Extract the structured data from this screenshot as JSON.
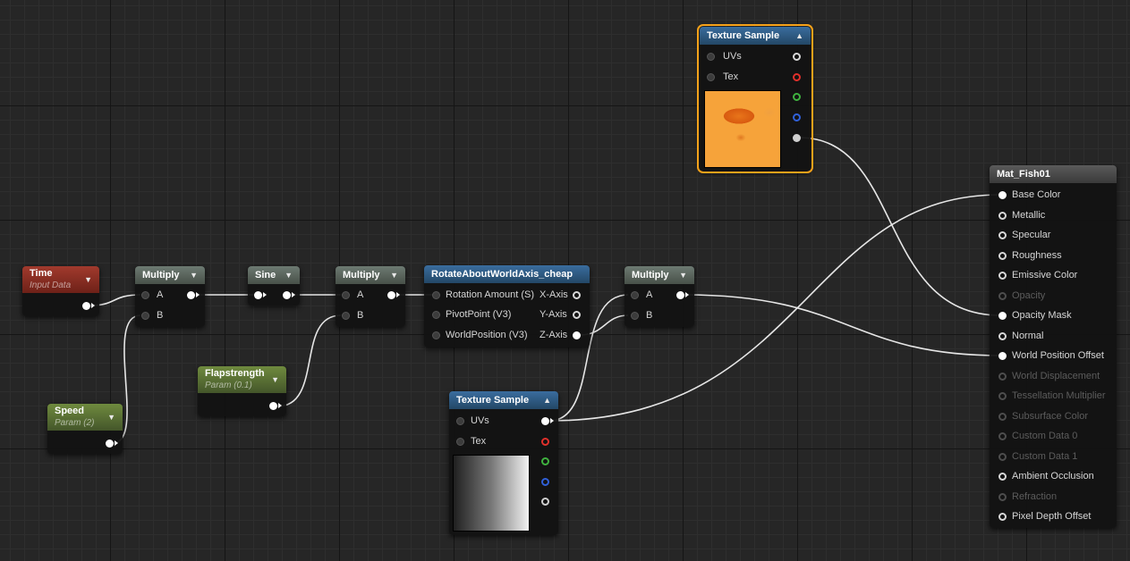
{
  "nodes": {
    "time": {
      "title": "Time",
      "subtitle": "Input Data"
    },
    "speed": {
      "title": "Speed",
      "subtitle": "Param (2)"
    },
    "multiply1": {
      "title": "Multiply",
      "pin_a": "A",
      "pin_b": "B"
    },
    "sine": {
      "title": "Sine"
    },
    "flapstrength": {
      "title": "Flapstrength",
      "subtitle": "Param (0.1)"
    },
    "multiply2": {
      "title": "Multiply",
      "pin_a": "A",
      "pin_b": "B"
    },
    "rotate": {
      "title": "RotateAboutWorldAxis_cheap",
      "inputs": [
        "Rotation Amount (S)",
        "PivotPoint (V3)",
        "WorldPosition (V3)"
      ],
      "outputs": [
        "X-Axis",
        "Y-Axis",
        "Z-Axis"
      ]
    },
    "multiply3": {
      "title": "Multiply",
      "pin_a": "A",
      "pin_b": "B"
    },
    "texture_top": {
      "title": "Texture Sample",
      "uvs": "UVs",
      "tex": "Tex"
    },
    "texture_bottom": {
      "title": "Texture Sample",
      "uvs": "UVs",
      "tex": "Tex"
    },
    "material": {
      "title": "Mat_Fish01",
      "pins": [
        "Base Color",
        "Metallic",
        "Specular",
        "Roughness",
        "Emissive Color",
        "Opacity",
        "Opacity Mask",
        "Normal",
        "World Position Offset",
        "World Displacement",
        "Tessellation Multiplier",
        "Subsurface Color",
        "Custom Data 0",
        "Custom Data 1",
        "Ambient Occlusion",
        "Refraction",
        "Pixel Depth Offset"
      ]
    }
  },
  "icons": {
    "collapse": "caret-down-icon",
    "expand": "caret-up-icon"
  },
  "colors": {
    "selection": "#f6a21a",
    "time_header": "#a13a2d",
    "param_header": "#6f8a3e",
    "math_header": "#6d7a72",
    "texture_header": "#3a6d9e",
    "pin_red": "#e0302b",
    "pin_green": "#3fb23f",
    "pin_blue": "#3060d8"
  }
}
